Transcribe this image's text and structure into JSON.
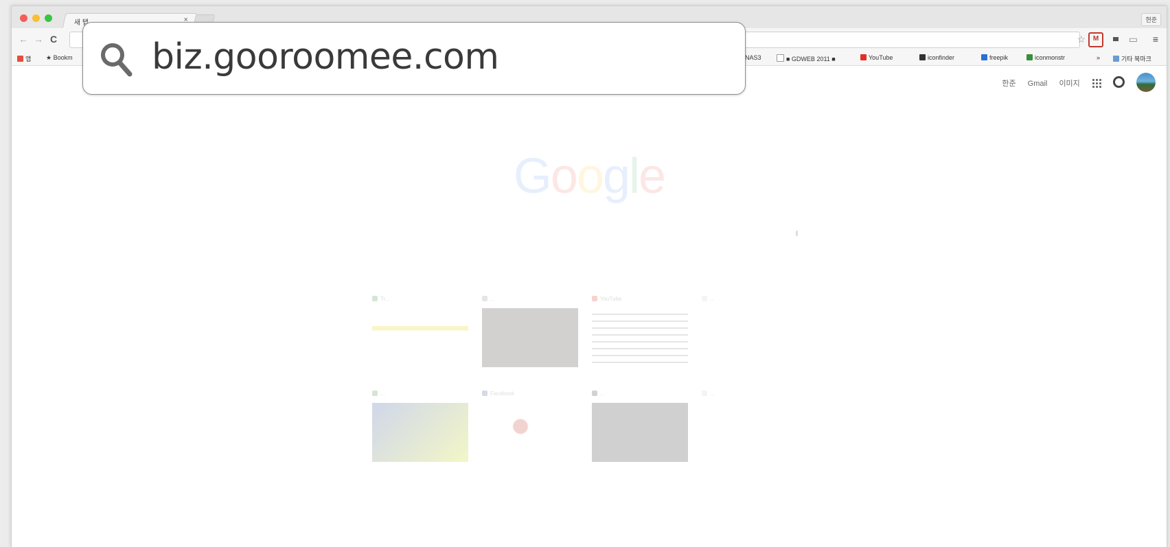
{
  "browser": {
    "tab_title": "새 탭",
    "tab_close": "×",
    "profile_label": "현준",
    "menu_icon": "hamburger-menu-icon"
  },
  "bookmarks": [
    {
      "label": "앱",
      "icon": "apps-icon",
      "color": "#e74c3c"
    },
    {
      "label": "Bookm",
      "icon": "star-icon",
      "color": "#555555"
    },
    {
      "label": "NAS3",
      "icon": "none",
      "color": "#888888"
    },
    {
      "label": "■ GDWEB 2011 ■",
      "icon": "page-icon",
      "color": "#888888"
    },
    {
      "label": "YouTube",
      "icon": "youtube-icon",
      "color": "#e52d27"
    },
    {
      "label": "iconfinder",
      "icon": "iconfinder-icon",
      "color": "#333333"
    },
    {
      "label": "freepik",
      "icon": "freepik-icon",
      "color": "#2a6fd6"
    },
    {
      "label": "iconmonstr",
      "icon": "iconmonstr-icon",
      "color": "#3a8e3a"
    },
    {
      "label": "»",
      "icon": "none",
      "color": "#555555"
    },
    {
      "label": "기타 북마크",
      "icon": "folder-icon",
      "color": "#6b9bd2"
    }
  ],
  "google": {
    "links": [
      "한준",
      "Gmail",
      "이미지"
    ],
    "logo": "Google"
  },
  "overlay": {
    "search_text": "biz.gooroomee.com"
  },
  "tiles": [
    {
      "title": "Tr..."
    },
    {
      "title": "..."
    },
    {
      "title": "YouTube"
    },
    {
      "title": "..."
    },
    {
      "title": "..."
    },
    {
      "title": "Facebook"
    },
    {
      "title": "..."
    },
    {
      "title": "..."
    }
  ]
}
